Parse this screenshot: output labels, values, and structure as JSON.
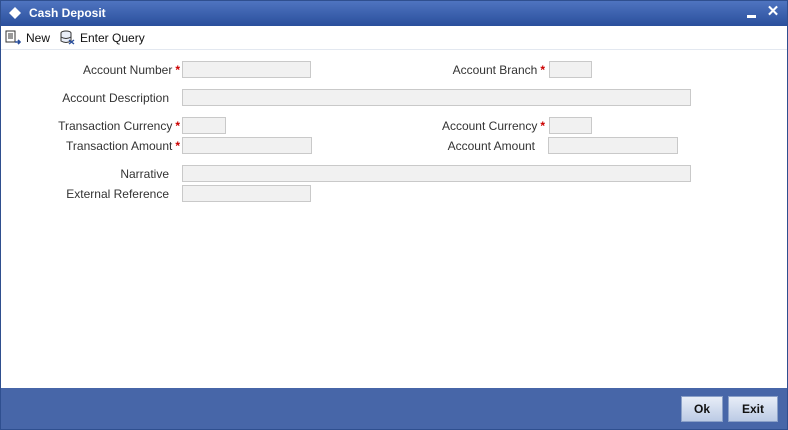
{
  "window": {
    "title": "Cash Deposit",
    "title_icon": "diamond-icon",
    "minimize_icon": "minimize-icon",
    "close_label": "✕"
  },
  "toolbar": {
    "new_label": "New",
    "new_icon": "new-record-icon",
    "query_label": "Enter Query",
    "query_icon": "database-query-icon"
  },
  "form": {
    "account_number": {
      "label": "Account Number",
      "required": "*",
      "value": ""
    },
    "account_branch": {
      "label": "Account Branch",
      "required": "*",
      "value": ""
    },
    "account_description": {
      "label": "Account Description",
      "value": ""
    },
    "transaction_currency": {
      "label": "Transaction Currency",
      "required": "*",
      "value": ""
    },
    "account_currency": {
      "label": "Account Currency",
      "required": "*",
      "value": ""
    },
    "transaction_amount": {
      "label": "Transaction Amount",
      "required": "*",
      "value": ""
    },
    "account_amount": {
      "label": "Account Amount",
      "value": ""
    },
    "narrative": {
      "label": "Narrative",
      "value": ""
    },
    "external_reference": {
      "label": "External Reference",
      "value": ""
    }
  },
  "footer": {
    "ok_label": "Ok",
    "exit_label": "Exit"
  },
  "colors": {
    "titlebar": "#3a5fae",
    "footer": "#4766a8",
    "required": "#cc0000",
    "field_bg": "#f1f1f1"
  }
}
